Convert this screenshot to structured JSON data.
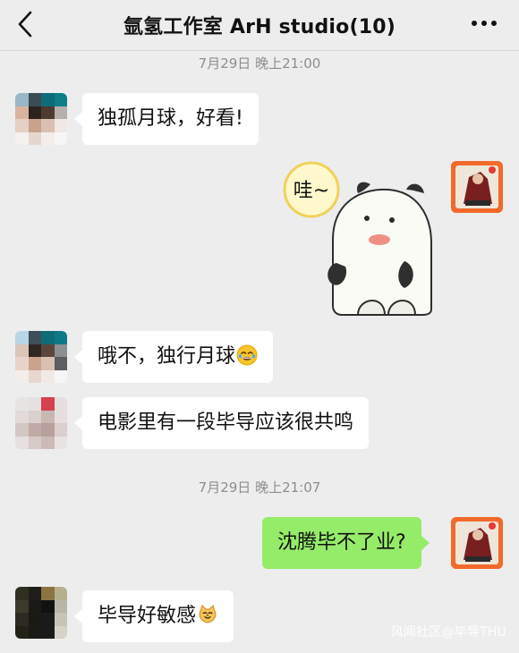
{
  "header": {
    "title": "氩氢工作室 ArH studio(10)"
  },
  "timestamps": [
    "7月29日 晚上21:00",
    "7月29日 晚上21:07"
  ],
  "messages": [
    {
      "text": "独孤月球，好看!"
    },
    {
      "sticker_text": "哇~"
    },
    {
      "text": "哦不，独行月球",
      "emoji": "crying-laughing-emoji"
    },
    {
      "text": "电影里有一段毕导应该很共鸣"
    },
    {
      "text": "沈腾毕不了业?"
    },
    {
      "text": "毕导好敏感",
      "emoji": "cat-face-emoji"
    }
  ],
  "watermark": "风闻社区@毕导THU",
  "colors": {
    "background": "#ededed",
    "self_bubble": "#95ec69",
    "other_bubble": "#ffffff"
  }
}
